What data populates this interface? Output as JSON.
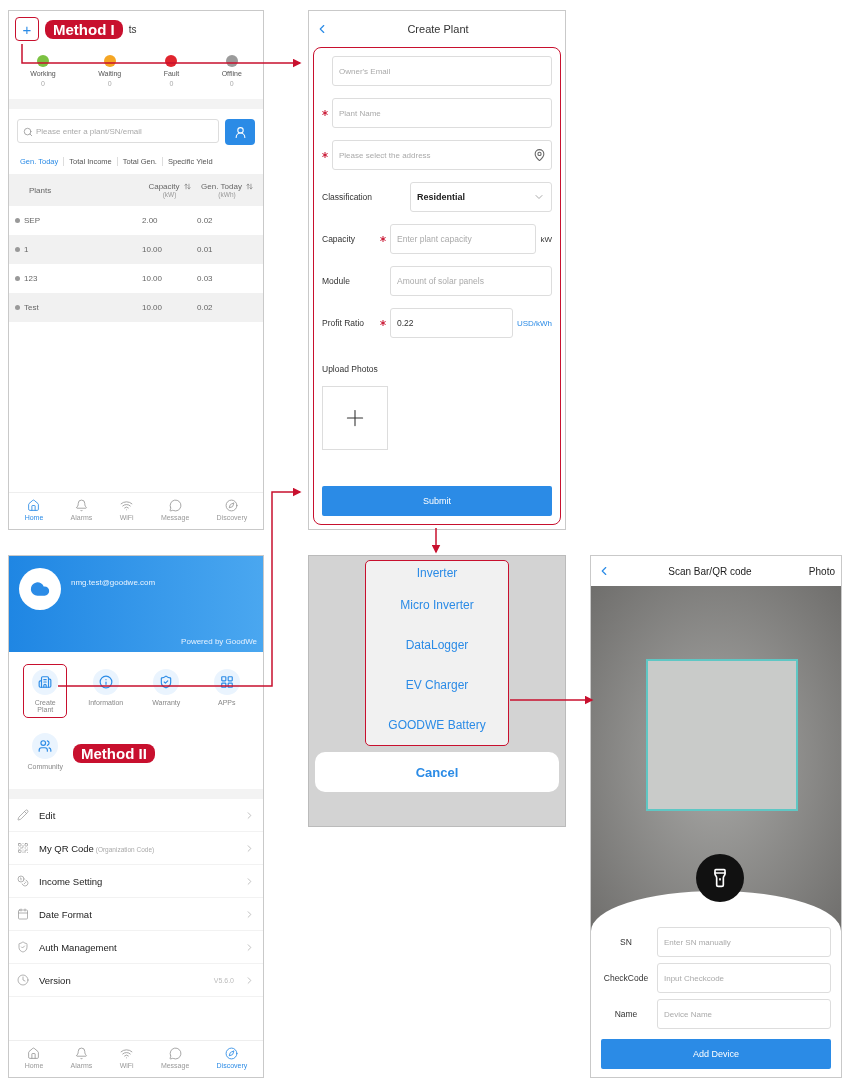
{
  "home_screen": {
    "add_button": {
      "label": "+",
      "highlighted": true
    },
    "callout": "Method I",
    "title_fragment": "ts",
    "status": [
      {
        "label": "Working",
        "count": "0",
        "color": "#7cc242"
      },
      {
        "label": "Waiting",
        "count": "0",
        "color": "#f5a623"
      },
      {
        "label": "Fault",
        "count": "0",
        "color": "#e0252e"
      },
      {
        "label": "Offline",
        "count": "0",
        "color": "#9b9b9b"
      }
    ],
    "search": {
      "placeholder": "Please enter a plant/SN/email"
    },
    "sort_tabs": [
      {
        "label": "Gen. Today",
        "selected": true
      },
      {
        "label": "Total Income",
        "selected": false
      },
      {
        "label": "Total Gen.",
        "selected": false
      },
      {
        "label": "Specific Yield",
        "selected": false
      }
    ],
    "table": {
      "columns": [
        {
          "label": "Plants"
        },
        {
          "label": "Capacity",
          "unit": "(kW)"
        },
        {
          "label": "Gen. Today",
          "unit": "(kWh)"
        }
      ],
      "rows": [
        [
          "SEP",
          "2.00",
          "0.02"
        ],
        [
          "1",
          "10.00",
          "0.01"
        ],
        [
          "123",
          "10.00",
          "0.03"
        ],
        [
          "Test",
          "10.00",
          "0.02"
        ]
      ]
    },
    "nav": [
      {
        "kind": "home",
        "label": "Home",
        "selected": true
      },
      {
        "kind": "alarm",
        "label": "Alarms",
        "selected": false
      },
      {
        "kind": "wifi",
        "label": "WiFi",
        "selected": false
      },
      {
        "kind": "message",
        "label": "Message",
        "selected": false
      },
      {
        "kind": "discovery",
        "label": "Discovery",
        "selected": false
      }
    ]
  },
  "create_plant": {
    "title": "Create Plant",
    "highlighted": true,
    "fields": [
      {
        "kind": "text",
        "placeholder": "Owner's Email",
        "required": false
      },
      {
        "kind": "text",
        "placeholder": "Plant Name",
        "required": true
      },
      {
        "kind": "address",
        "placeholder": "Please select the address",
        "required": true
      },
      {
        "kind": "select",
        "label": "Classification",
        "value": "Residential"
      },
      {
        "kind": "labeled",
        "label": "Capacity",
        "required": true,
        "placeholder": "Enter plant capacity",
        "unit": "kW"
      },
      {
        "kind": "labeled",
        "label": "Module",
        "required": false,
        "placeholder": "Amount of solar panels"
      },
      {
        "kind": "labeled",
        "label": "Profit Ratio",
        "required": true,
        "value": "0.22",
        "unit": "USD/kWh"
      }
    ],
    "upload_label": "Upload Photos",
    "submit": "Submit"
  },
  "discovery_screen": {
    "email": "nmg.test@goodwe.com",
    "powered_by": "Powered by GoodWe",
    "callout": "Method II",
    "shortcuts": [
      {
        "kind": "plant",
        "label": "Create Plant",
        "highlighted": true
      },
      {
        "kind": "info",
        "label": "Information",
        "highlighted": false
      },
      {
        "kind": "warranty",
        "label": "Warranty",
        "highlighted": false
      },
      {
        "kind": "apps",
        "label": "APPs",
        "highlighted": false
      },
      {
        "kind": "community",
        "label": "Community",
        "highlighted": false
      }
    ],
    "menu": [
      {
        "kind": "edit",
        "label": "Edit"
      },
      {
        "kind": "qr",
        "label": "My QR Code",
        "note": "(Organization Code)"
      },
      {
        "kind": "income",
        "label": "Income Setting"
      },
      {
        "kind": "date",
        "label": "Date Format"
      },
      {
        "kind": "auth",
        "label": "Auth Management"
      },
      {
        "kind": "version",
        "label": "Version",
        "value": "V5.6.0"
      }
    ],
    "nav": [
      {
        "kind": "home",
        "label": "Home",
        "selected": false
      },
      {
        "kind": "alarm",
        "label": "Alarms",
        "selected": false
      },
      {
        "kind": "wifi",
        "label": "WiFi",
        "selected": false
      },
      {
        "kind": "message",
        "label": "Message",
        "selected": false
      },
      {
        "kind": "discovery",
        "label": "Discovery",
        "selected": true
      }
    ]
  },
  "device_sheet": {
    "highlighted": true,
    "options": [
      "Inverter",
      "Micro Inverter",
      "DataLogger",
      "EV Charger",
      "GOODWE Battery"
    ],
    "cancel": "Cancel"
  },
  "scan_screen": {
    "title": "Scan Bar/QR code",
    "photo": "Photo",
    "fields": [
      {
        "label": "SN",
        "placeholder": "Enter SN manually"
      },
      {
        "label": "CheckCode",
        "placeholder": "Input Checkcode"
      },
      {
        "label": "Name",
        "placeholder": "Device Name"
      }
    ],
    "submit": "Add Device"
  }
}
